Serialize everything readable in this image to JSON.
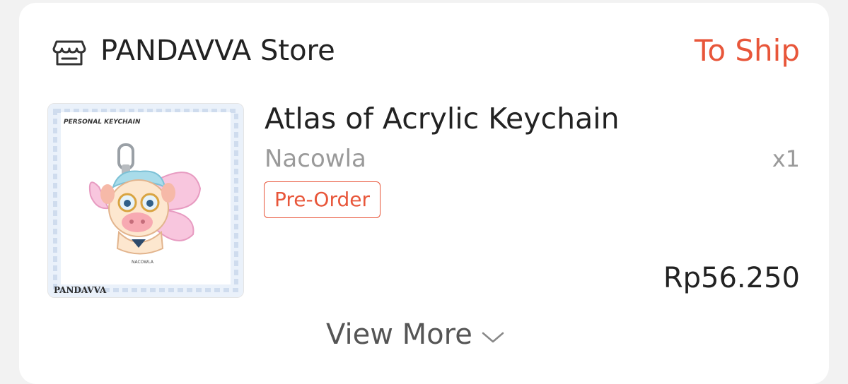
{
  "store": {
    "name": "PANDAVVA Store",
    "icon": "storefront-icon"
  },
  "order": {
    "status": "To Ship",
    "status_color": "#e8563a"
  },
  "item": {
    "name": "Atlas of Acrylic Keychain",
    "variant": "Nacowla",
    "quantity": "x1",
    "badge": "Pre-Order",
    "price": "Rp56.250",
    "image": {
      "header_text": "PERSONAL KEYCHAIN",
      "name_text": "NACOWLA",
      "brand_text": "PANDAVVA"
    }
  },
  "footer": {
    "view_more_label": "View More",
    "view_more_icon": "chevron-down-icon"
  }
}
